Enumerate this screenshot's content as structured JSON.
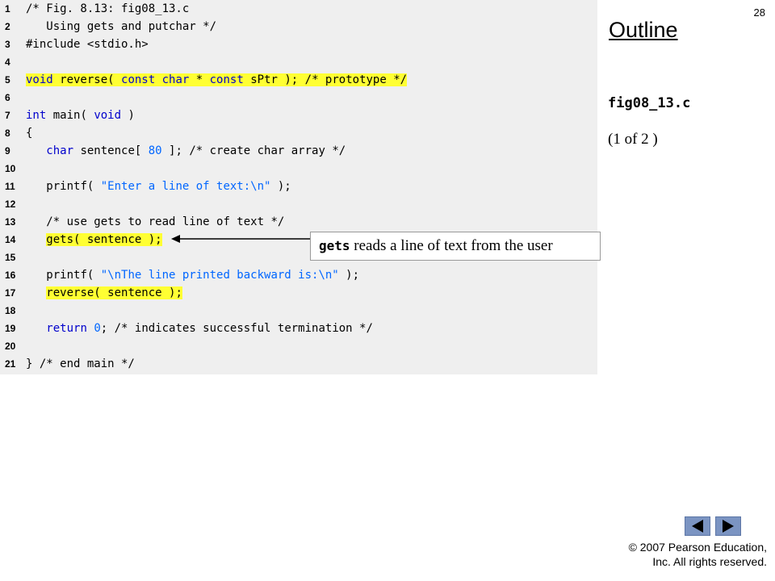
{
  "page_number": "28",
  "outline": {
    "title": "Outline",
    "file_name": "fig08_13.c",
    "part": "(1 of 2 )"
  },
  "code_lines": [
    {
      "n": "1",
      "segments": [
        {
          "t": "/* Fig. 8.13: fig08_13.c",
          "c": "cmt"
        }
      ]
    },
    {
      "n": "2",
      "segments": [
        {
          "t": "   Using gets and putchar */",
          "c": "cmt"
        }
      ]
    },
    {
      "n": "3",
      "segments": [
        {
          "t": "#include <stdio.h>",
          "c": "plain"
        }
      ]
    },
    {
      "n": "4",
      "segments": []
    },
    {
      "n": "5",
      "highlight": true,
      "segments": [
        {
          "t": "void",
          "c": "kw"
        },
        {
          "t": " reverse( ",
          "c": "plain"
        },
        {
          "t": "const",
          "c": "kw"
        },
        {
          "t": " ",
          "c": "plain"
        },
        {
          "t": "char",
          "c": "kw"
        },
        {
          "t": " * ",
          "c": "plain"
        },
        {
          "t": "const",
          "c": "kw"
        },
        {
          "t": " sPtr ); ",
          "c": "plain"
        },
        {
          "t": "/* prototype */",
          "c": "cmt"
        }
      ]
    },
    {
      "n": "6",
      "segments": []
    },
    {
      "n": "7",
      "segments": [
        {
          "t": "int",
          "c": "kw"
        },
        {
          "t": " main( ",
          "c": "plain"
        },
        {
          "t": "void",
          "c": "kw"
        },
        {
          "t": " )",
          "c": "plain"
        }
      ]
    },
    {
      "n": "8",
      "segments": [
        {
          "t": "{",
          "c": "plain"
        }
      ]
    },
    {
      "n": "9",
      "segments": [
        {
          "t": "   ",
          "c": "plain"
        },
        {
          "t": "char",
          "c": "kw"
        },
        {
          "t": " sentence[ ",
          "c": "plain"
        },
        {
          "t": "80",
          "c": "num"
        },
        {
          "t": " ]; ",
          "c": "plain"
        },
        {
          "t": "/* create char array */",
          "c": "cmt"
        }
      ]
    },
    {
      "n": "10",
      "segments": []
    },
    {
      "n": "11",
      "segments": [
        {
          "t": "   printf( ",
          "c": "plain"
        },
        {
          "t": "\"Enter a line of text:\\n\"",
          "c": "str"
        },
        {
          "t": " );",
          "c": "plain"
        }
      ]
    },
    {
      "n": "12",
      "segments": []
    },
    {
      "n": "13",
      "segments": [
        {
          "t": "   /* use gets to read line of text */",
          "c": "cmt"
        }
      ]
    },
    {
      "n": "14",
      "highlight": true,
      "segments": [
        {
          "t": "   gets( sentence );",
          "c": "plain"
        }
      ]
    },
    {
      "n": "15",
      "segments": []
    },
    {
      "n": "16",
      "segments": [
        {
          "t": "   printf( ",
          "c": "plain"
        },
        {
          "t": "\"\\nThe line printed backward is:\\n\"",
          "c": "str"
        },
        {
          "t": " );",
          "c": "plain"
        }
      ]
    },
    {
      "n": "17",
      "highlight": true,
      "segments": [
        {
          "t": "   reverse( sentence );",
          "c": "plain"
        }
      ]
    },
    {
      "n": "18",
      "segments": []
    },
    {
      "n": "19",
      "segments": [
        {
          "t": "   ",
          "c": "plain"
        },
        {
          "t": "return",
          "c": "kw"
        },
        {
          "t": " ",
          "c": "plain"
        },
        {
          "t": "0",
          "c": "num"
        },
        {
          "t": "; ",
          "c": "plain"
        },
        {
          "t": "/* indicates successful termination */",
          "c": "cmt"
        }
      ]
    },
    {
      "n": "20",
      "segments": []
    },
    {
      "n": "21",
      "segments": [
        {
          "t": "} ",
          "c": "plain"
        },
        {
          "t": "/* end main */",
          "c": "cmt"
        }
      ]
    }
  ],
  "callout": {
    "code_word": "gets",
    "text": " reads a line of text from the user"
  },
  "nav": {
    "prev_icon": "triangle-left-icon",
    "next_icon": "triangle-right-icon"
  },
  "copyright": {
    "line1": "© 2007 Pearson Education,",
    "line2": "Inc.  All rights reserved."
  },
  "colors": {
    "highlight": "#ffff33",
    "keyword": "#0000cc",
    "string": "#0066ff",
    "code_background": "#efefef",
    "nav_button": "#7b94c2"
  }
}
